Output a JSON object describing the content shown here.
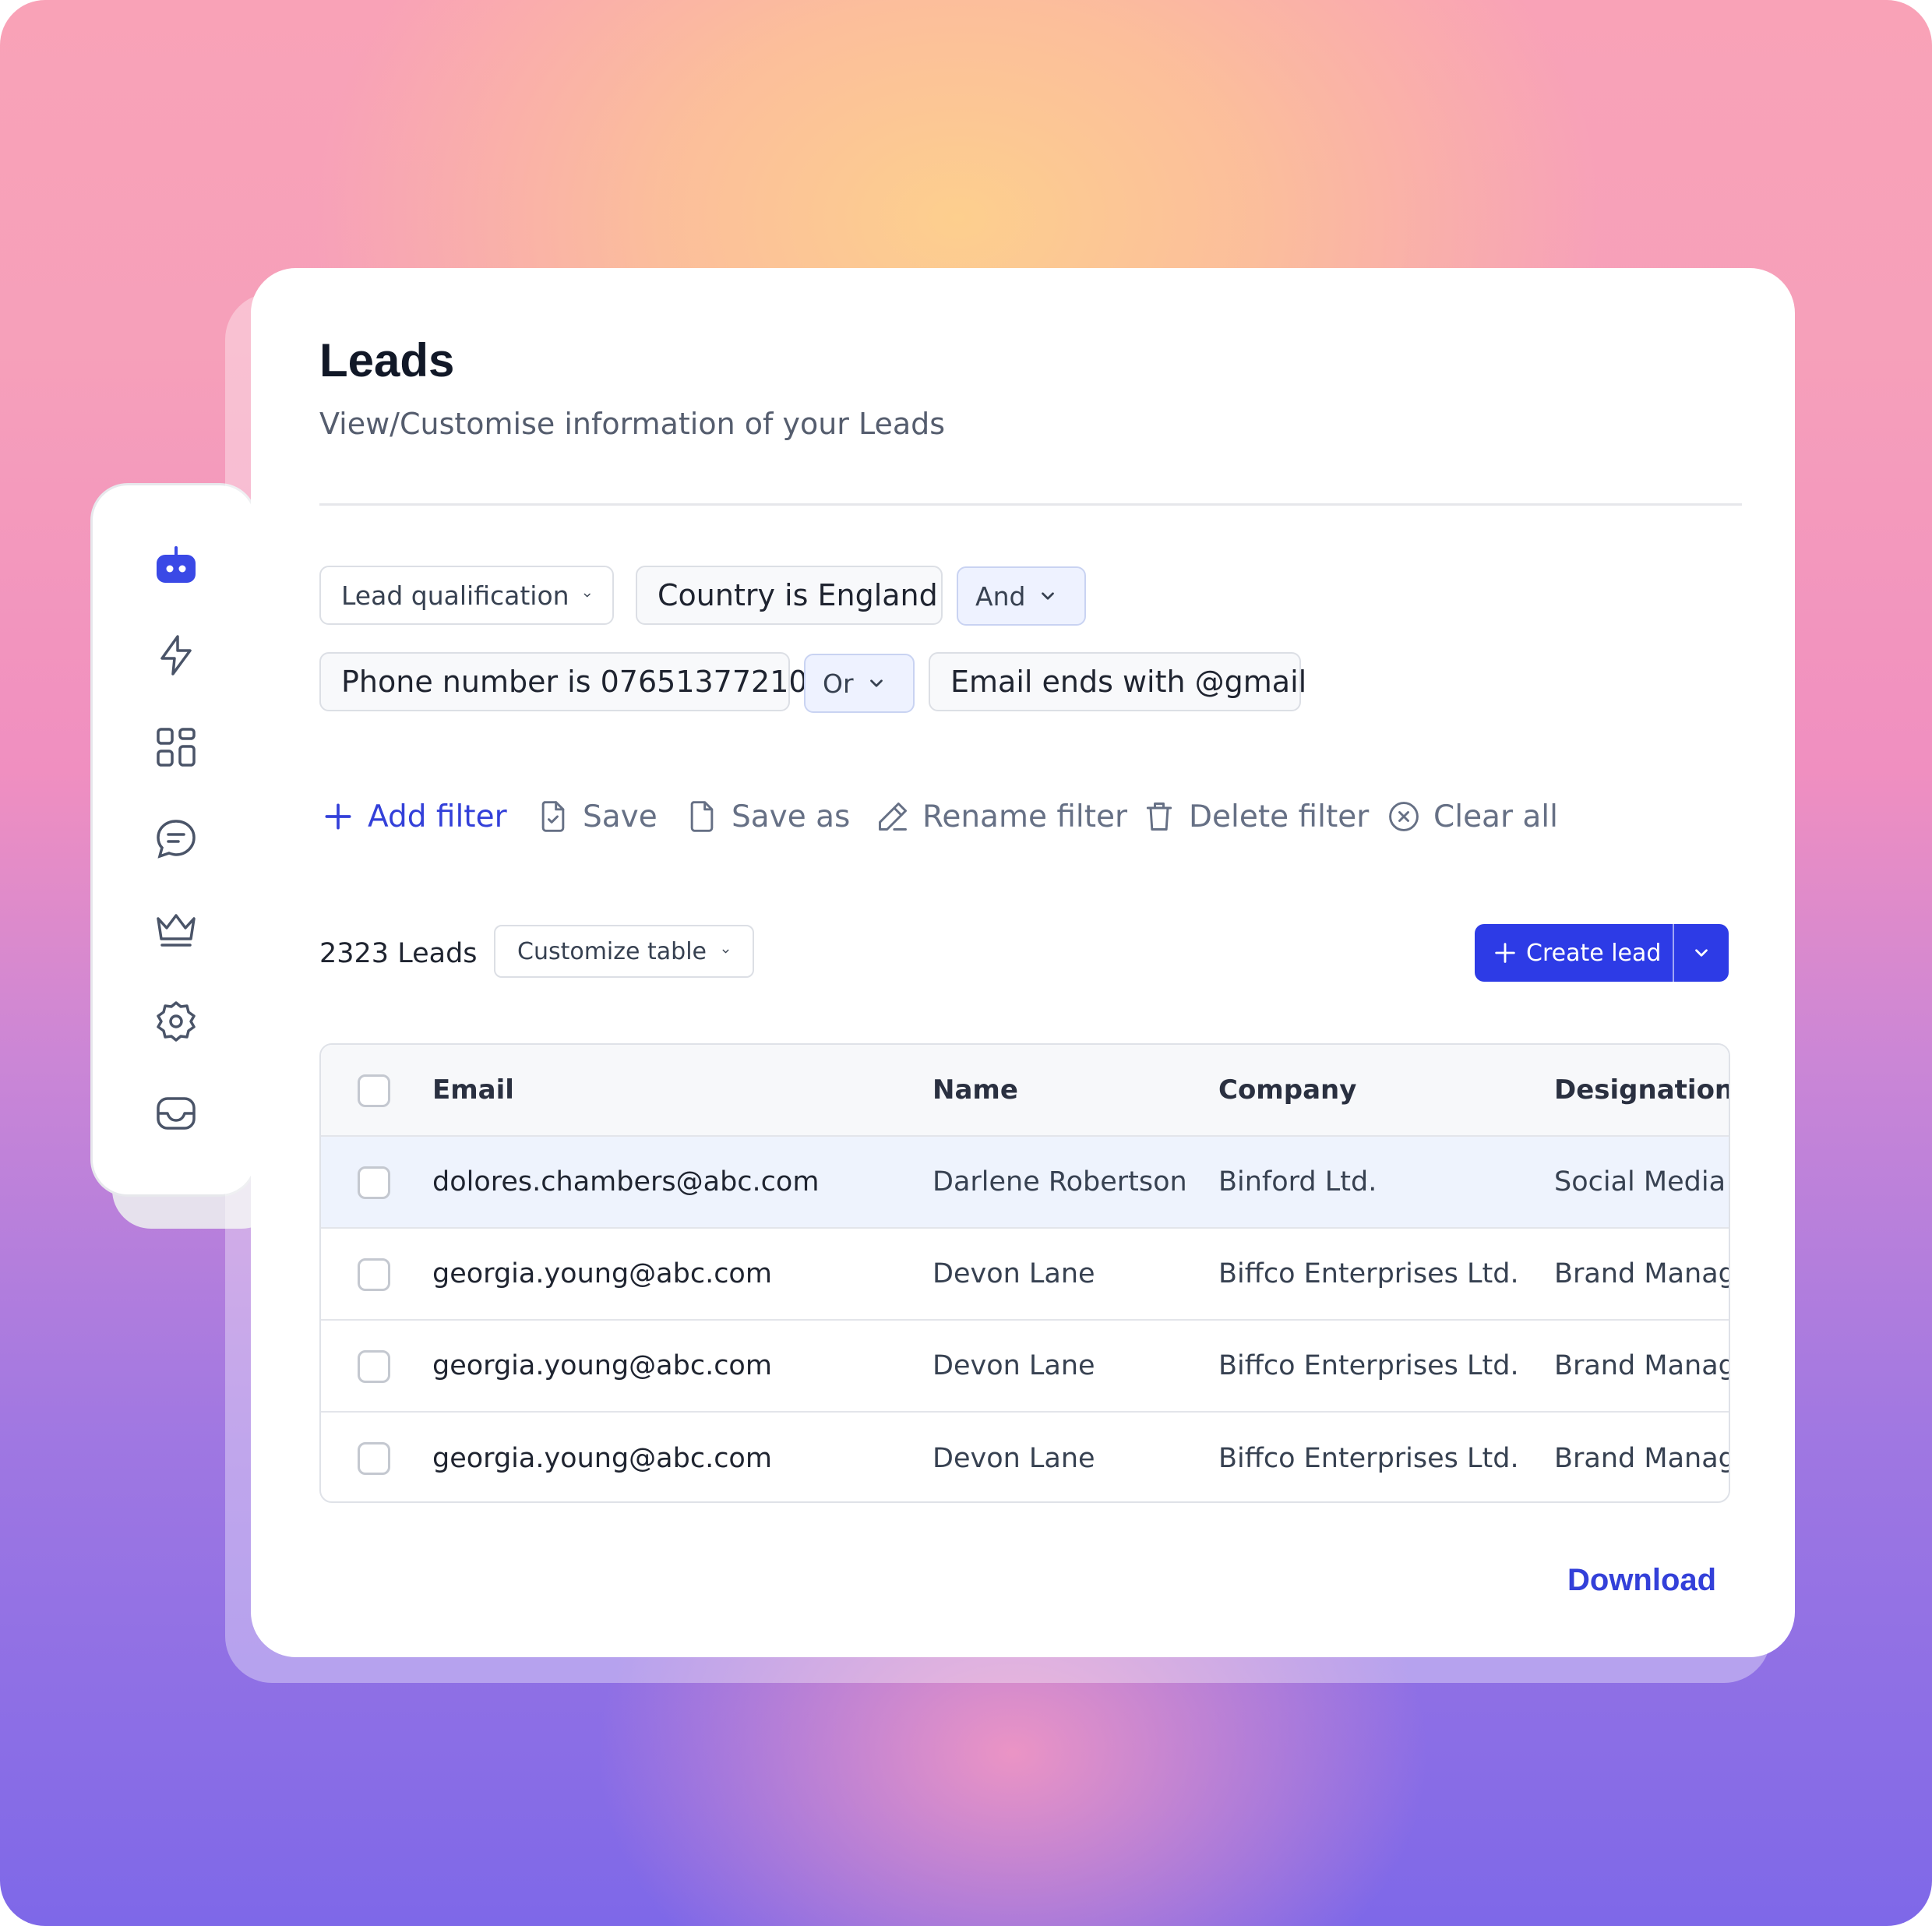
{
  "page": {
    "title": "Leads",
    "subtitle": "View/Customise information of your Leads"
  },
  "sidebar": {
    "icons": [
      "bot-icon",
      "lightning-icon",
      "dashboard-icon",
      "chat-icon",
      "crown-icon",
      "settings-icon",
      "inbox-icon"
    ]
  },
  "filters": {
    "lead_qualification": "Lead qualification",
    "country": "Country is England",
    "op_and": "And",
    "phone": "Phone number is 07651377210",
    "op_or": "Or",
    "email": "Email ends with @gmail"
  },
  "actions": {
    "add_filter": "Add filter",
    "save": "Save",
    "save_as": "Save as",
    "rename": "Rename filter",
    "delete": "Delete filter",
    "clear": "Clear all"
  },
  "toolbar": {
    "count": "2323 Leads",
    "customize": "Customize table",
    "create": "Create lead"
  },
  "table": {
    "headers": {
      "email": "Email",
      "name": "Name",
      "company": "Company",
      "designation": "Designation"
    },
    "rows": [
      {
        "email": "dolores.chambers@abc.com",
        "name": "Darlene Robertson",
        "company": "Binford Ltd.",
        "designation": "Social Media"
      },
      {
        "email": "georgia.young@abc.com",
        "name": "Devon Lane",
        "company": "Biffco Enterprises Ltd.",
        "designation": "Brand Manag"
      },
      {
        "email": "georgia.young@abc.com",
        "name": "Devon Lane",
        "company": "Biffco Enterprises Ltd.",
        "designation": "Brand Manag"
      },
      {
        "email": "georgia.young@abc.com",
        "name": "Devon Lane",
        "company": "Biffco Enterprises Ltd.",
        "designation": "Brand Manag"
      }
    ]
  },
  "footer": {
    "download": "Download"
  },
  "colors": {
    "accent": "#2d3be6",
    "selected_row": "#eef3fd"
  }
}
